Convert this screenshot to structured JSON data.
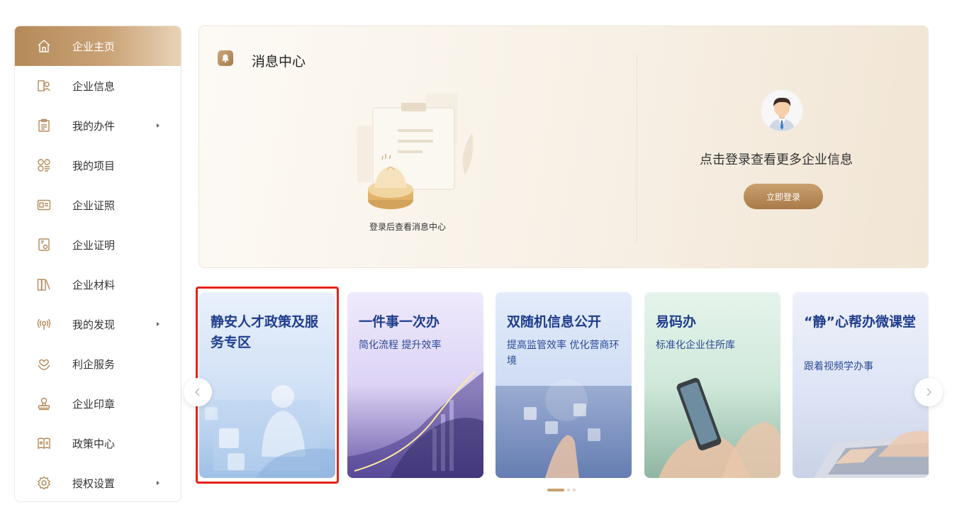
{
  "sidebar": {
    "items": [
      {
        "label": "企业主页",
        "icon": "home-icon",
        "active": true,
        "arrow": false
      },
      {
        "label": "企业信息",
        "icon": "company-info-icon",
        "active": false,
        "arrow": false
      },
      {
        "label": "我的办件",
        "icon": "clipboard-icon",
        "active": false,
        "arrow": true
      },
      {
        "label": "我的项目",
        "icon": "projects-icon",
        "active": false,
        "arrow": false
      },
      {
        "label": "企业证照",
        "icon": "license-icon",
        "active": false,
        "arrow": false
      },
      {
        "label": "企业证明",
        "icon": "certificate-icon",
        "active": false,
        "arrow": false
      },
      {
        "label": "企业材料",
        "icon": "materials-icon",
        "active": false,
        "arrow": false
      },
      {
        "label": "我的发现",
        "icon": "broadcast-icon",
        "active": false,
        "arrow": true
      },
      {
        "label": "利企服务",
        "icon": "service-icon",
        "active": false,
        "arrow": false
      },
      {
        "label": "企业印章",
        "icon": "seal-icon",
        "active": false,
        "arrow": false
      },
      {
        "label": "政策中心",
        "icon": "policy-icon",
        "active": false,
        "arrow": false
      },
      {
        "label": "授权设置",
        "icon": "gear-icon",
        "active": false,
        "arrow": true
      }
    ]
  },
  "message_center": {
    "title": "消息中心",
    "hint": "登录后查看消息中心",
    "login_hint": "点击登录查看更多企业信息",
    "login_button": "立即登录"
  },
  "cards": [
    {
      "title": "静安人才政策及服务专区",
      "subtitle": "",
      "highlighted": true
    },
    {
      "title": "一件事一次办",
      "subtitle": "简化流程 提升效率"
    },
    {
      "title": "双随机信息公开",
      "subtitle": "提高监管效率 优化营商环境"
    },
    {
      "title": "易码办",
      "subtitle": "标准化企业住所库"
    },
    {
      "title": "“静”心帮办微课堂",
      "subtitle": "跟着视频学办事"
    }
  ],
  "colors": {
    "accent": "#c9a06f",
    "card_title": "#1f3d8c",
    "highlight": "#e4221b"
  }
}
